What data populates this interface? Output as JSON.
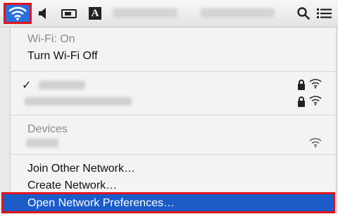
{
  "menubar": {
    "wifi_icon": "wifi-icon",
    "volume_icon": "volume-icon",
    "display_icon": "display-mirroring-icon",
    "input_source": "A",
    "search_icon": "spotlight-search-icon",
    "list_icon": "notification-center-icon"
  },
  "menu": {
    "status": "Wi-Fi: On",
    "toggle_label": "Turn Wi-Fi Off",
    "devices_header": "Devices",
    "join_label": "Join Other Network…",
    "create_label": "Create Network…",
    "prefs_label": "Open Network Preferences…",
    "check_mark": "✓"
  },
  "colors": {
    "menubar_bg": "#ececec",
    "highlight": "#1b5cc8",
    "annotation_red": "#e0141b"
  }
}
